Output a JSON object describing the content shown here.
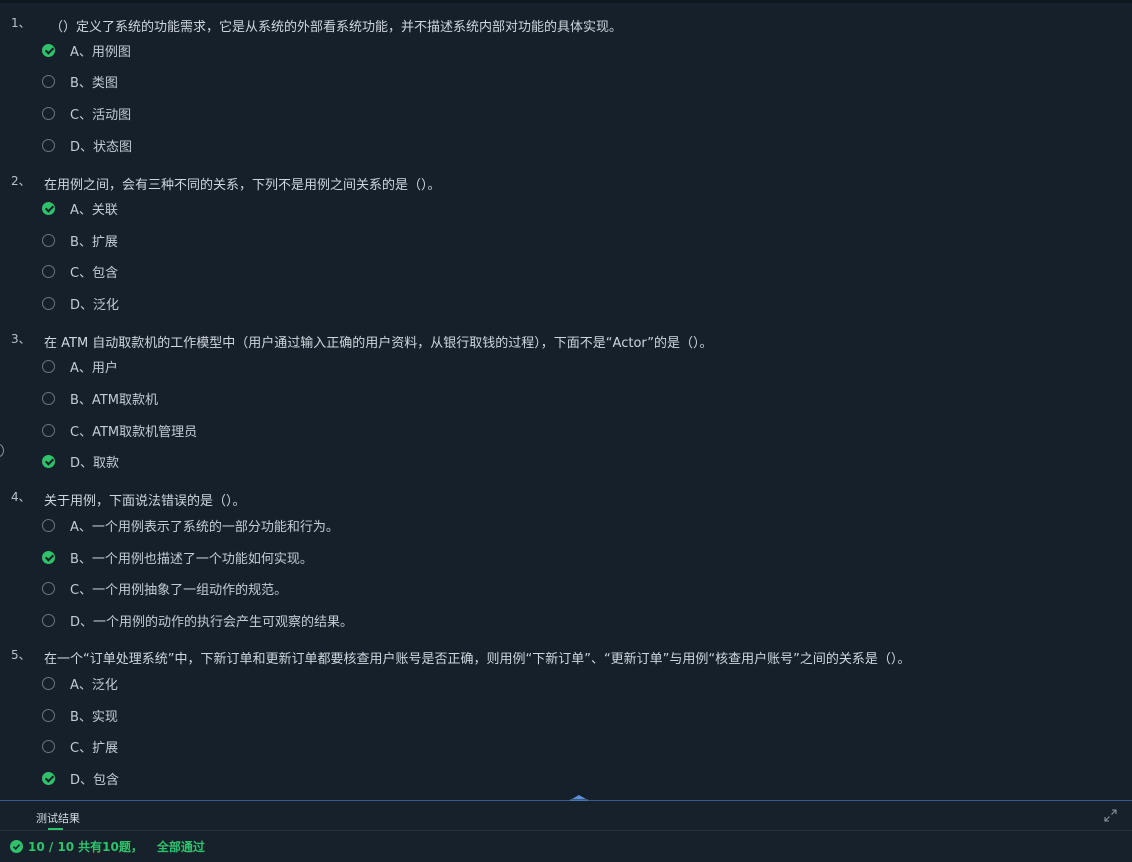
{
  "questions": [
    {
      "number": "1、",
      "text": "（）定义了系统的功能需求，它是从系统的外部看系统功能，并不描述系统内部对功能的具体实现。",
      "options": [
        {
          "label": "A、用例图",
          "checked": true
        },
        {
          "label": "B、类图",
          "checked": false
        },
        {
          "label": "C、活动图",
          "checked": false
        },
        {
          "label": "D、状态图",
          "checked": false
        }
      ]
    },
    {
      "number": "2、",
      "text": "在用例之间，会有三种不同的关系，下列不是用例之间关系的是（）。",
      "options": [
        {
          "label": "A、关联",
          "checked": true
        },
        {
          "label": "B、扩展",
          "checked": false
        },
        {
          "label": "C、包含",
          "checked": false
        },
        {
          "label": "D、泛化",
          "checked": false
        }
      ]
    },
    {
      "number": "3、",
      "text": "在 ATM 自动取款机的工作模型中（用户通过输入正确的用户资料，从银行取钱的过程），下面不是“Actor”的是（）。",
      "options": [
        {
          "label": "A、用户",
          "checked": false
        },
        {
          "label": "B、ATM取款机",
          "checked": false
        },
        {
          "label": "C、ATM取款机管理员",
          "checked": false
        },
        {
          "label": "D、取款",
          "checked": true
        }
      ]
    },
    {
      "number": "4、",
      "text": "关于用例，下面说法错误的是（）。",
      "options": [
        {
          "label": "A、一个用例表示了系统的一部分功能和行为。",
          "checked": false
        },
        {
          "label": "B、一个用例也描述了一个功能如何实现。",
          "checked": true
        },
        {
          "label": "C、一个用例抽象了一组动作的规范。",
          "checked": false
        },
        {
          "label": "D、一个用例的动作的执行会产生可观察的结果。",
          "checked": false
        }
      ]
    },
    {
      "number": "5、",
      "text": "在一个“订单处理系统”中，下新订单和更新订单都要核查用户账号是否正确，则用例“下新订单”、“更新订单”与用例“核查用户账号”之间的关系是（）。",
      "options": [
        {
          "label": "A、泛化",
          "checked": false
        },
        {
          "label": "B、实现",
          "checked": false
        },
        {
          "label": "C、扩展",
          "checked": false
        },
        {
          "label": "D、包含",
          "checked": true
        }
      ]
    }
  ],
  "panel": {
    "tab_label": "测试结果",
    "result_count": "10 / 10",
    "result_total": "共有10题，",
    "result_status": "全部通过"
  },
  "colors": {
    "accent": "#2ec36b",
    "background": "#16202a",
    "divider": "#3a5a8c"
  },
  "icons": {
    "checked": "check-circle-icon",
    "expand": "expand-icon",
    "split": "split-handle-icon"
  }
}
